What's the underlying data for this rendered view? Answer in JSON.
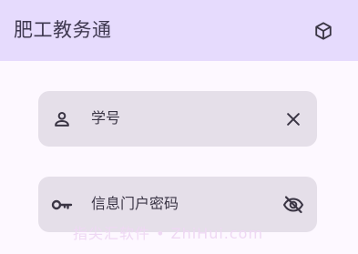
{
  "app_bar": {
    "title": "肥工教务通",
    "action_icon": "cube-icon"
  },
  "form": {
    "username": {
      "label": "学号",
      "leading_icon": "person-icon",
      "trailing_icon": "close-icon"
    },
    "password": {
      "label": "信息门户密码",
      "leading_icon": "key-icon",
      "trailing_icon": "visibility-off-icon"
    }
  },
  "watermark": "指尖汇软件 • ZhiHui.com",
  "colors": {
    "app_bar_background": "#e6dbfd",
    "page_background": "#fdf8ff",
    "field_background": "#e5dfe9",
    "text": "#3b3646",
    "icon": "#3a3544"
  }
}
